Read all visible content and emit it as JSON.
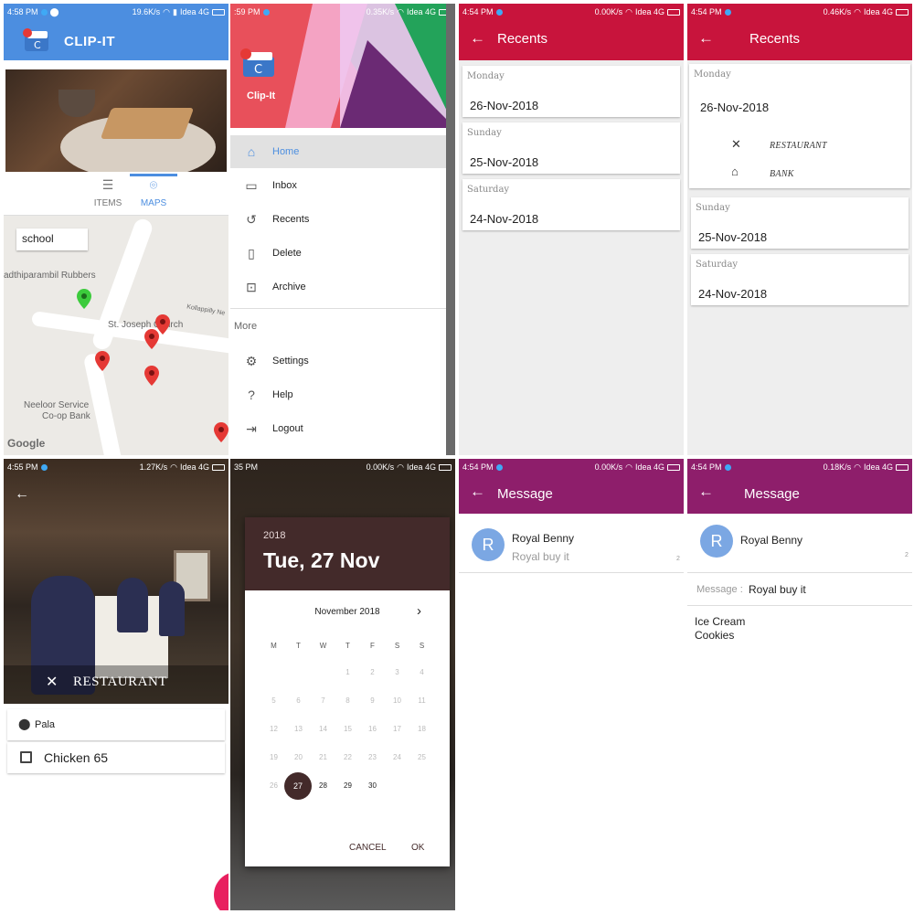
{
  "panel1": {
    "status": {
      "time": "4:58 PM",
      "speed": "19.6K/s",
      "carrier": "Idea 4G"
    },
    "app_title": "CLIP-IT",
    "tabs": [
      {
        "label": "ITEMS"
      },
      {
        "label": "MAPS"
      }
    ],
    "search_value": "school",
    "map_labels": [
      "adthiparambil Rubbers",
      "St. Joseph Church",
      "Kollappilly Ne",
      "Neeloor Service",
      "Co-op Bank"
    ],
    "google": "Google"
  },
  "panel2": {
    "status": {
      "time": ":59 PM",
      "speed": "0.35K/s",
      "carrier": "Idea 4G"
    },
    "app_name": "Clip-It",
    "menu": [
      {
        "label": "Home",
        "icon": "home-icon"
      },
      {
        "label": "Inbox",
        "icon": "inbox-icon"
      },
      {
        "label": "Recents",
        "icon": "history-icon"
      },
      {
        "label": "Delete",
        "icon": "trash-icon"
      },
      {
        "label": "Archive",
        "icon": "archive-icon"
      }
    ],
    "more_label": "More",
    "more_menu": [
      {
        "label": "Settings",
        "icon": "gear-icon"
      },
      {
        "label": "Help",
        "icon": "help-icon"
      },
      {
        "label": "Logout",
        "icon": "logout-icon"
      }
    ]
  },
  "panel3": {
    "status": {
      "time": "4:54 PM",
      "speed": "0.00K/s",
      "carrier": "Idea 4G"
    },
    "title": "Recents",
    "cards": [
      {
        "day": "Monday",
        "date": "26-Nov-2018"
      },
      {
        "day": "Sunday",
        "date": "25-Nov-2018"
      },
      {
        "day": "Saturday",
        "date": "24-Nov-2018"
      }
    ]
  },
  "panel4": {
    "status": {
      "time": "4:54 PM",
      "speed": "0.46K/s",
      "carrier": "Idea 4G"
    },
    "title": "Recents",
    "cards": [
      {
        "day": "Monday",
        "date": "26-Nov-2018",
        "items": [
          "RESTAURANT",
          "BANK"
        ]
      },
      {
        "day": "Sunday",
        "date": "25-Nov-2018"
      },
      {
        "day": "Saturday",
        "date": "24-Nov-2018"
      }
    ]
  },
  "panel5": {
    "status": {
      "time": "4:55 PM",
      "speed": "1.27K/s",
      "carrier": "Idea 4G"
    },
    "caption": "RESTAURANT",
    "location": "Pala",
    "item": "Chicken 65"
  },
  "panel6": {
    "status": {
      "time": "35 PM",
      "speed": "0.00K/s",
      "carrier": "Idea 4G"
    },
    "year": "2018",
    "big_date": "Tue, 27 Nov",
    "month": "November 2018",
    "weekdays": [
      "M",
      "T",
      "W",
      "T",
      "F",
      "S",
      "S"
    ],
    "selected_day": "27",
    "cancel": "CANCEL",
    "ok": "OK"
  },
  "panel7": {
    "status": {
      "time": "4:54 PM",
      "speed": "0.00K/s",
      "carrier": "Idea 4G"
    },
    "title": "Message",
    "avatar": "R",
    "name": "Royal Benny",
    "preview": "Royal buy it",
    "time_short": "2"
  },
  "panel8": {
    "status": {
      "time": "4:54 PM",
      "speed": "0.18K/s",
      "carrier": "Idea 4G"
    },
    "title": "Message",
    "avatar": "R",
    "name": "Royal Benny",
    "time_short": "2",
    "message_label": "Message :",
    "message_text": "Royal buy it",
    "items": [
      "Ice Cream",
      "Cookies"
    ]
  },
  "colors": {
    "blue": "#4c8ee0",
    "red": "#c8143c",
    "purple": "#8e1e6b",
    "dialog": "#432a2a"
  }
}
